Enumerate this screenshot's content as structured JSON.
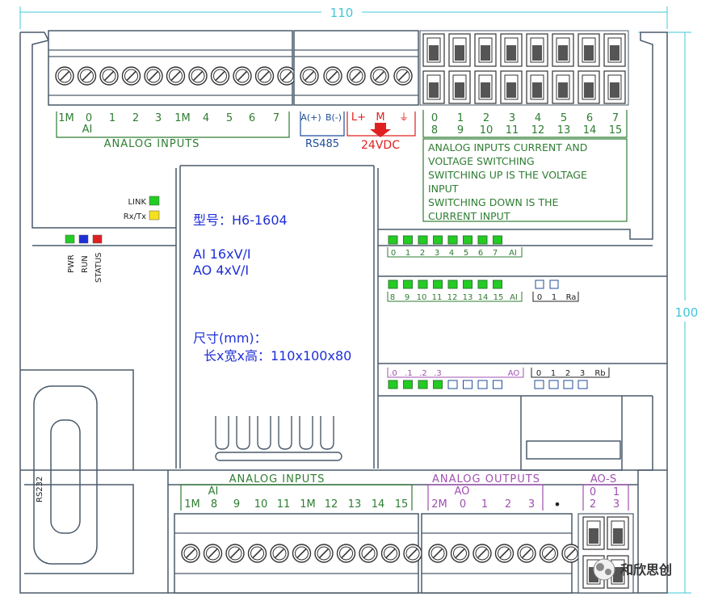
{
  "dimensions": {
    "width": "110",
    "height": "100"
  },
  "top": {
    "analog_inputs_left": {
      "terminals": [
        "1M",
        "0",
        "1",
        "2",
        "3",
        "1M",
        "4",
        "5",
        "6",
        "7"
      ],
      "group_label": "AI",
      "title": "ANALOG INPUTS"
    },
    "rs485": {
      "terminals": [
        "A(+)",
        "B(-)"
      ],
      "title": "RS485"
    },
    "power": {
      "terminals": [
        "L+",
        "M",
        "⏚"
      ],
      "title": "24VDC"
    },
    "dip_top_numbers": [
      "0",
      "1",
      "2",
      "3",
      "4",
      "5",
      "6",
      "7"
    ],
    "dip_bottom_numbers": [
      "8",
      "9",
      "10",
      "11",
      "12",
      "13",
      "14",
      "15"
    ],
    "switch_note": [
      "ANALOG INPUTS CURRENT AND",
      "VOLTAGE SWITCHING",
      "SWITCHING UP IS THE VOLTAGE",
      "INPUT",
      "SWITCHING DOWN IS THE",
      "CURRENT INPUT"
    ]
  },
  "status": {
    "link": "LINK",
    "rxtx": "Rx/Tx",
    "pwr": "PWR",
    "run": "RUN",
    "status": "STATUS",
    "rs232": "RS232"
  },
  "colors": {
    "green": "#22cc22",
    "blue": "#1f2fd8",
    "red": "#e02020",
    "yellow": "#f5e020",
    "term_green": "#2e7d32",
    "term_blue": "#1f4e9a",
    "term_red": "#e02020",
    "term_purple": "#a050b0",
    "dim": "#40c8d8"
  },
  "label": {
    "model": "型号：H6-1604",
    "ai": "AI 16xV/I",
    "ao": "AO 4xV/I",
    "size_title": "尺寸(mm)：",
    "size_value": "长x宽x高：110x100x80"
  },
  "indicators": {
    "row1": [
      "0",
      "1",
      "2",
      "3",
      "4",
      "5",
      "6",
      "7",
      "AI"
    ],
    "row2": [
      "8",
      "9",
      "10",
      "11",
      "12",
      "13",
      "14",
      "15",
      "AI"
    ],
    "ra": [
      "0",
      "1",
      "Ra"
    ],
    "ao_row": [
      ".0",
      ".1",
      ".2",
      ".3",
      "AO"
    ],
    "rb": [
      "0",
      "1",
      "2",
      "3",
      "Rb"
    ]
  },
  "bottom": {
    "analog_inputs": {
      "title": "ANALOG INPUTS",
      "group_label": "AI",
      "terminals": [
        "1M",
        "8",
        "9",
        "10",
        "11",
        "1M",
        "12",
        "13",
        "14",
        "15"
      ]
    },
    "analog_outputs": {
      "title": "ANALOG OUTPUTS",
      "group_label": "AO",
      "terminals": [
        "2M",
        "0",
        "1",
        "2",
        "3",
        "•"
      ]
    },
    "ao_s": {
      "title": "AO-S",
      "top": [
        "0",
        "1"
      ],
      "bottom": [
        "2",
        "3"
      ]
    }
  },
  "watermark": "和欣思创"
}
